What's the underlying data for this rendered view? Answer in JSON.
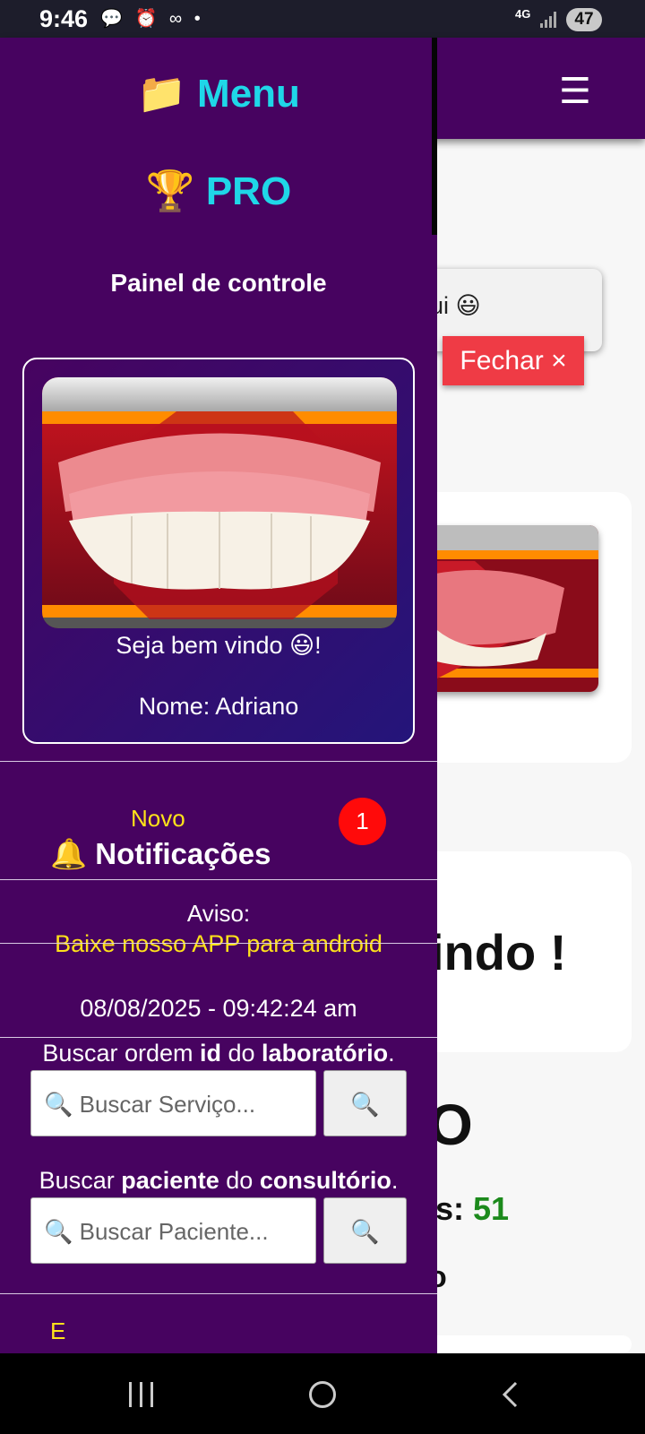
{
  "status_bar": {
    "time": "9:46",
    "left_icons": "💬 ⏰ ∞ •",
    "network": "4G",
    "battery": "47"
  },
  "background_page": {
    "toast_text": "ui 😃",
    "close_label": "Fechar ×",
    "big_text": "indo !",
    "big_letter": "O",
    "count_prefix": "s: ",
    "count_value": "51",
    "letter_o": "o"
  },
  "drawer": {
    "menu_title": "📁 Menu",
    "pro_title": "🏆 PRO",
    "panel_label": "Painel de controle",
    "welcome_text": "Seja bem vindo 😃!",
    "name_text": "Nome: Adriano",
    "notifications": {
      "new_label": "Novo",
      "label": "🔔 Notificações",
      "badge_count": "1"
    },
    "notice": {
      "label": "Aviso:",
      "text": "Baixe nosso APP para android"
    },
    "datetime": "08/08/2025 - 09:42:24 am",
    "search_order": {
      "label_parts": [
        "Buscar ordem ",
        "id",
        " do ",
        "laboratório",
        "."
      ],
      "placeholder": "🔍 Buscar Serviço...",
      "button": "🔍"
    },
    "search_patient": {
      "label_parts": [
        "Buscar ",
        "paciente",
        " do ",
        "consultório",
        "."
      ],
      "placeholder": "🔍 Buscar Paciente...",
      "button": "🔍"
    },
    "bottom_text": "E"
  }
}
